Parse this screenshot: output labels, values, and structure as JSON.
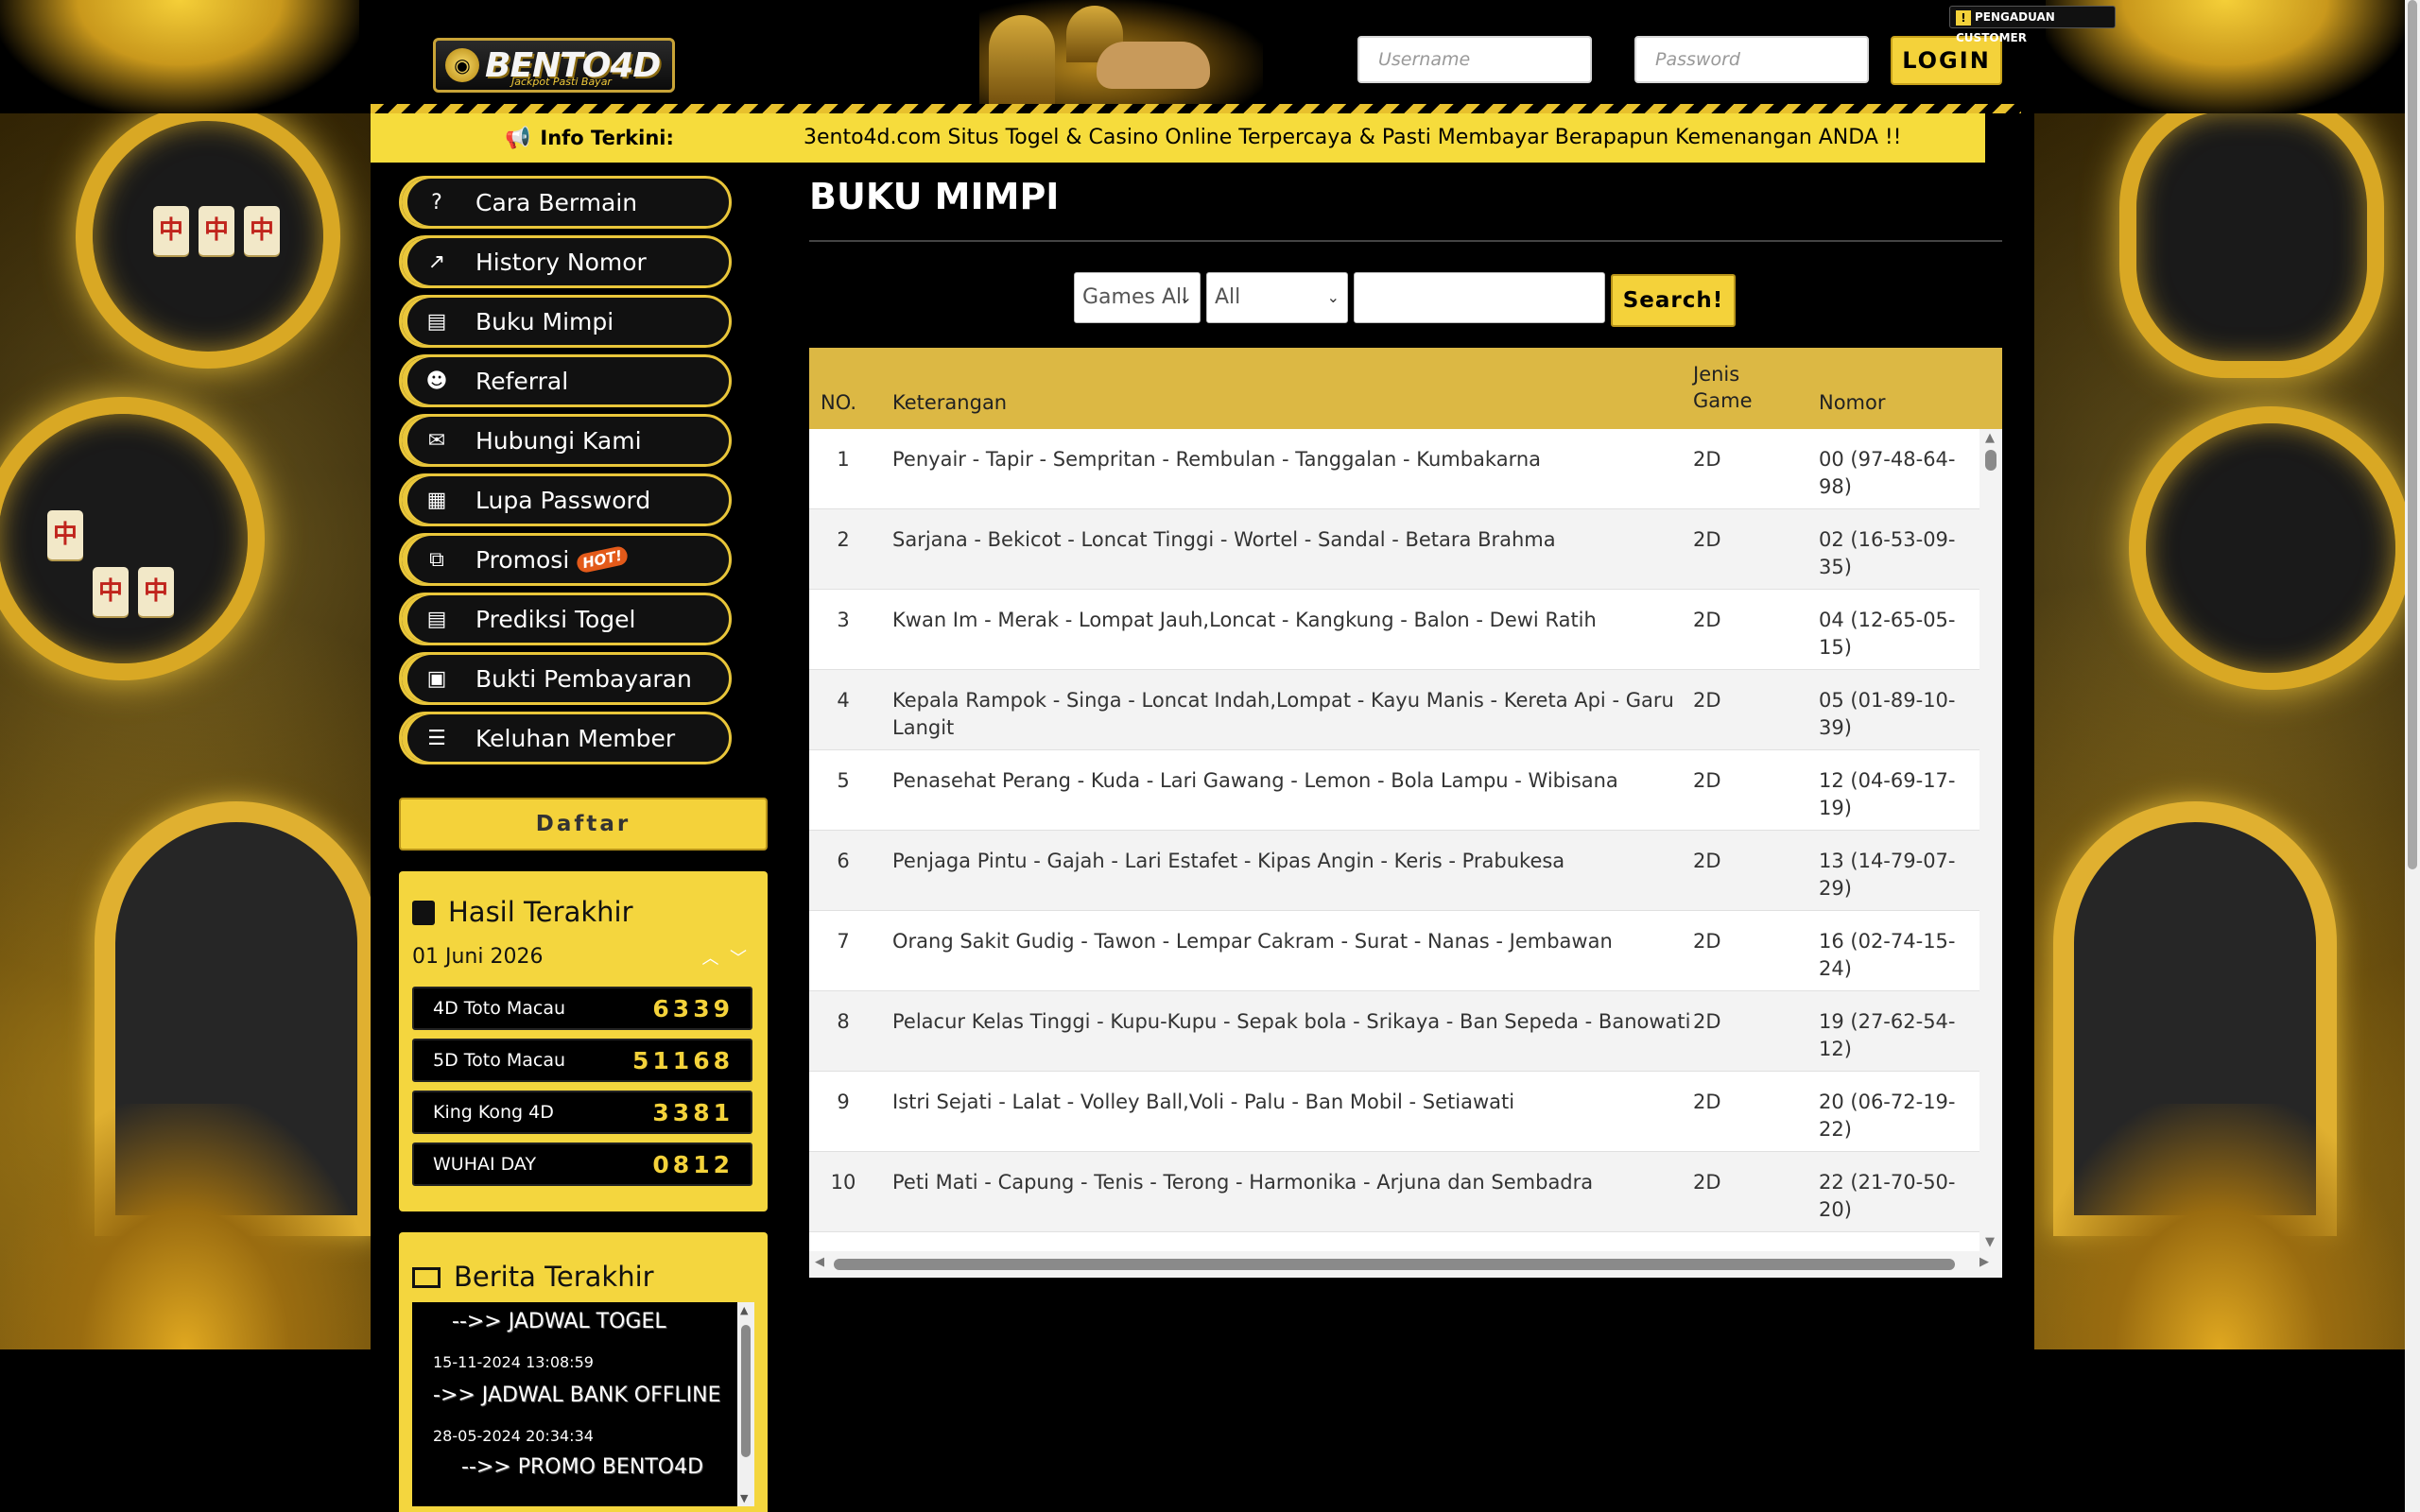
{
  "header": {
    "logo_text": "BENTO4D",
    "logo_tagline": "Jackpot Pasti Bayar",
    "username_placeholder": "Username",
    "password_placeholder": "Password",
    "login_label": "LOGIN",
    "complaint_label": "PENGADUAN CUSTOMER"
  },
  "infobar": {
    "label": "Info Terkini:",
    "message": "3ento4d.com Situs Togel & Casino Online Terpercaya & Pasti Membayar Berapapun Kemenangan ANDA !!"
  },
  "menu": [
    {
      "label": "Cara Bermain",
      "icon": "question-circle-icon",
      "glyph": "?"
    },
    {
      "label": "History Nomor",
      "icon": "line-chart-icon",
      "glyph": "↗"
    },
    {
      "label": "Buku Mimpi",
      "icon": "newspaper-icon",
      "glyph": "▤"
    },
    {
      "label": "Referral",
      "icon": "users-icon",
      "glyph": "☻"
    },
    {
      "label": "Hubungi Kami",
      "icon": "chat-icon",
      "glyph": "✉"
    },
    {
      "label": "Lupa Password",
      "icon": "calendar-icon",
      "glyph": "▦"
    },
    {
      "label": "Promosi",
      "icon": "clone-icon",
      "glyph": "⧉",
      "badge": "HOT!"
    },
    {
      "label": "Prediksi Togel",
      "icon": "newspaper-icon",
      "glyph": "▤"
    },
    {
      "label": "Bukti Pembayaran",
      "icon": "money-icon",
      "glyph": "▣"
    },
    {
      "label": "Keluhan Member",
      "icon": "list-icon",
      "glyph": "☰"
    }
  ],
  "daftar_label": "Daftar",
  "results": {
    "title": "Hasil Terakhir",
    "date": "01 Juni 2026",
    "rows": [
      {
        "name": "4D Toto Macau",
        "number": "6339"
      },
      {
        "name": "5D Toto Macau",
        "number": "51168"
      },
      {
        "name": "King Kong 4D",
        "number": "3381"
      },
      {
        "name": "WUHAI DAY",
        "number": "0812"
      }
    ]
  },
  "news": {
    "title": "Berita Terakhir",
    "items": [
      {
        "title": "-->> JADWAL TOGEL",
        "date": "15-11-2024 13:08:59"
      },
      {
        "title": "->> JADWAL BANK OFFLINE",
        "date": "28-05-2024 20:34:34"
      },
      {
        "title": "-->> PROMO BENTO4D",
        "date": ""
      }
    ]
  },
  "content": {
    "page_title": "BUKU MIMPI",
    "filter_games": "Games All",
    "filter_all": "All",
    "search_label": "Search!",
    "columns": {
      "no": "NO.",
      "keterangan": "Keterangan",
      "jenis_line1": "Jenis",
      "jenis_line2": "Game",
      "nomor": "Nomor"
    },
    "rows": [
      {
        "no": "1",
        "ket": "Penyair - Tapir - Sempritan - Rembulan - Tanggalan - Kumbakarna",
        "jenis": "2D",
        "nomor": "00 (97-48-64-98)"
      },
      {
        "no": "2",
        "ket": "Sarjana - Bekicot - Loncat Tinggi - Wortel - Sandal - Betara Brahma",
        "jenis": "2D",
        "nomor": "02 (16-53-09-35)"
      },
      {
        "no": "3",
        "ket": "Kwan Im - Merak - Lompat Jauh,Loncat - Kangkung - Balon - Dewi Ratih",
        "jenis": "2D",
        "nomor": "04 (12-65-05-15)"
      },
      {
        "no": "4",
        "ket": "Kepala Rampok - Singa - Loncat Indah,Lompat - Kayu Manis - Kereta Api - Garu Langit",
        "jenis": "2D",
        "nomor": "05 (01-89-10-39)"
      },
      {
        "no": "5",
        "ket": "Penasehat Perang - Kuda - Lari Gawang - Lemon - Bola Lampu - Wibisana",
        "jenis": "2D",
        "nomor": "12 (04-69-17-19)"
      },
      {
        "no": "6",
        "ket": "Penjaga Pintu - Gajah - Lari Estafet - Kipas Angin - Keris - Prabukesa",
        "jenis": "2D",
        "nomor": "13 (14-79-07-29)"
      },
      {
        "no": "7",
        "ket": "Orang Sakit Gudig - Tawon - Lempar Cakram - Surat - Nanas - Jembawan",
        "jenis": "2D",
        "nomor": "16 (02-74-15-24)"
      },
      {
        "no": "8",
        "ket": "Pelacur Kelas Tinggi - Kupu-Kupu - Sepak bola - Srikaya - Ban Sepeda - Banowati",
        "jenis": "2D",
        "nomor": "19 (27-62-54-12)"
      },
      {
        "no": "9",
        "ket": "Istri Sejati - Lalat - Volley Ball,Voli - Palu - Ban Mobil - Setiawati",
        "jenis": "2D",
        "nomor": "20 (06-72-19-22)"
      },
      {
        "no": "10",
        "ket": "Peti Mati - Capung - Tenis - Terong - Harmonika - Arjuna dan Sembadra",
        "jenis": "2D",
        "nomor": "22 (21-70-50-20)"
      }
    ]
  }
}
